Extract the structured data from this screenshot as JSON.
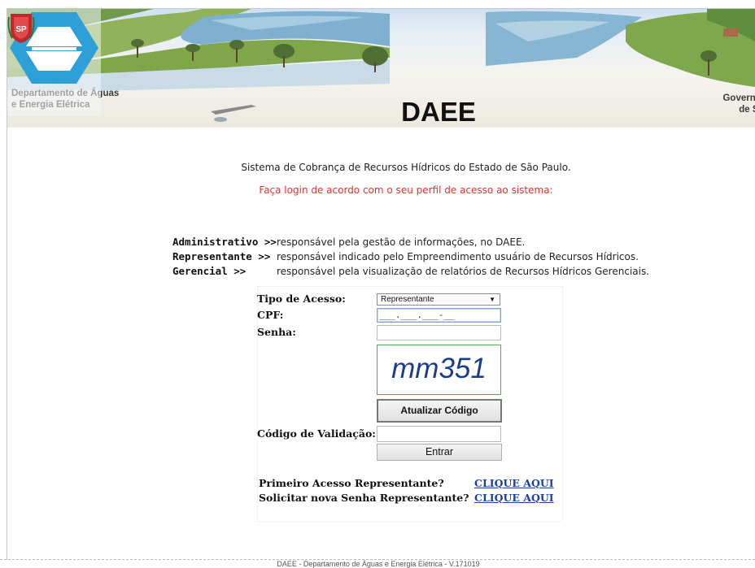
{
  "header": {
    "department_line1": "Departamento de Águas",
    "department_line2": "e Energia Elétrica",
    "logo_text": "DAEE",
    "government_line1": "Governo d",
    "government_line2": "de São"
  },
  "main": {
    "system_title": "Sistema de Cobrança de Recursos Hídricos do Estado de São Paulo.",
    "login_hint": "Faça login de acordo com o seu perfil de acesso ao sistema:",
    "profiles": [
      {
        "name": "Administrativo >>",
        "description": "responsável pela gestão de informações, no DAEE."
      },
      {
        "name": "Representante >>",
        "description": "responsável indicado pelo Empreendimento usuário de Recursos Hídricos."
      },
      {
        "name": "Gerencial >>",
        "description": "responsável pela visualização de relatórios de Recursos Hídricos Gerenciais."
      }
    ]
  },
  "form": {
    "access_type_label": "Tipo de Acesso:",
    "access_type_value": "Representante",
    "cpf_label": "CPF:",
    "cpf_value": "___.___.___-__",
    "password_label": "Senha:",
    "password_value": "",
    "captcha_text": "mm351",
    "refresh_button": "Atualizar Código",
    "validation_label": "Código de Validação:",
    "validation_value": "",
    "enter_button": "Entrar"
  },
  "links": {
    "first_access_label": "Primeiro Acesso Representante?",
    "first_access_link": "CLIQUE AQUI",
    "new_password_label": "Solicitar nova Senha Representante?",
    "new_password_link": "CLIQUE AQUI"
  },
  "footer": {
    "text": "DAEE - Departamento de Águas e Energia Elétrica - V.171019"
  },
  "colors": {
    "hint_red": "#e8302b",
    "link_blue": "#1a3ea8",
    "logo_blue": "#2f9fd8",
    "captcha_border": "#4caf50"
  }
}
